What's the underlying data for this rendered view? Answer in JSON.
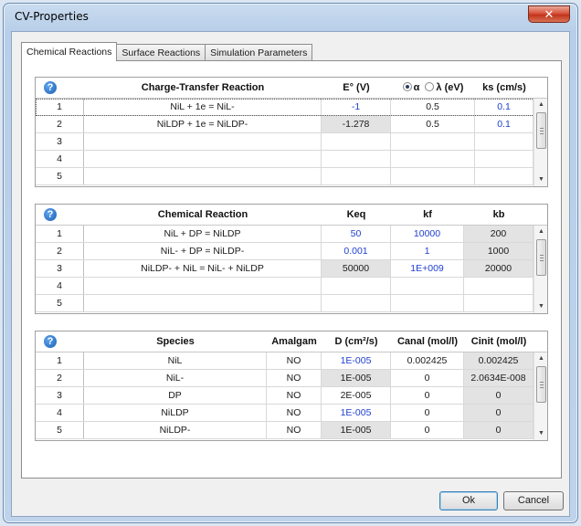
{
  "window": {
    "title": "CV-Properties",
    "close_glyph": "✕"
  },
  "tabs": [
    "Chemical Reactions",
    "Surface Reactions",
    "Simulation Parameters"
  ],
  "help_glyph": "?",
  "grid1": {
    "headers": {
      "reaction": "Charge-Transfer Reaction",
      "e0": "E° (V)",
      "alpha": "α",
      "lambda": "λ (eV)",
      "ks": "ks (cm/s)"
    },
    "rows": [
      {
        "idx": "1",
        "reaction": "NiL + 1e = NiL-",
        "e0": "-1",
        "alpha": "0.5",
        "ks": "0.1"
      },
      {
        "idx": "2",
        "reaction": "NiLDP + 1e = NiLDP-",
        "e0": "-1.278",
        "alpha": "0.5",
        "ks": "0.1"
      },
      {
        "idx": "3",
        "reaction": "",
        "e0": "",
        "alpha": "",
        "ks": ""
      },
      {
        "idx": "4",
        "reaction": "",
        "e0": "",
        "alpha": "",
        "ks": ""
      },
      {
        "idx": "5",
        "reaction": "",
        "e0": "",
        "alpha": "",
        "ks": ""
      }
    ]
  },
  "grid2": {
    "headers": {
      "reaction": "Chemical Reaction",
      "keq": "Keq",
      "kf": "kf",
      "kb": "kb"
    },
    "rows": [
      {
        "idx": "1",
        "reaction": "NiL + DP = NiLDP",
        "keq": "50",
        "kf": "10000",
        "kb": "200"
      },
      {
        "idx": "2",
        "reaction": "NiL- + DP = NiLDP-",
        "keq": "0.001",
        "kf": "1",
        "kb": "1000"
      },
      {
        "idx": "3",
        "reaction": "NiLDP- + NiL = NiL- + NiLDP",
        "keq": "50000",
        "kf": "1E+009",
        "kb": "20000"
      },
      {
        "idx": "4",
        "reaction": "",
        "keq": "",
        "kf": "",
        "kb": ""
      },
      {
        "idx": "5",
        "reaction": "",
        "keq": "",
        "kf": "",
        "kb": ""
      }
    ]
  },
  "grid3": {
    "headers": {
      "species": "Species",
      "amalgam": "Amalgam",
      "d": "D (cm²/s)",
      "canal": "Canal (mol/l)",
      "cinit": "Cinit (mol/l)"
    },
    "rows": [
      {
        "idx": "1",
        "species": "NiL",
        "amalgam": "NO",
        "d": "1E-005",
        "canal": "0.002425",
        "cinit": "0.002425"
      },
      {
        "idx": "2",
        "species": "NiL-",
        "amalgam": "NO",
        "d": "1E-005",
        "canal": "0",
        "cinit": "2.0634E-008"
      },
      {
        "idx": "3",
        "species": "DP",
        "amalgam": "NO",
        "d": "2E-005",
        "canal": "0",
        "cinit": "0"
      },
      {
        "idx": "4",
        "species": "NiLDP",
        "amalgam": "NO",
        "d": "1E-005",
        "canal": "0",
        "cinit": "0"
      },
      {
        "idx": "5",
        "species": "NiLDP-",
        "amalgam": "NO",
        "d": "1E-005",
        "canal": "0",
        "cinit": "0"
      }
    ]
  },
  "buttons": {
    "ok": "Ok",
    "cancel": "Cancel"
  },
  "colors": {
    "accent_blue": "#1f3fcf",
    "readonly_gray": "#e3e3e3"
  },
  "scroll_arrows": {
    "up": "▲",
    "down": "▼"
  }
}
